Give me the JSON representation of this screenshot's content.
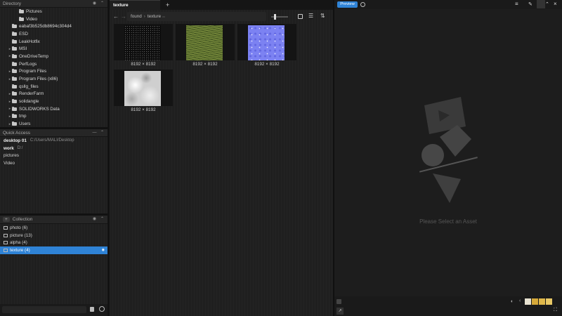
{
  "directory": {
    "title": "Directory",
    "items": [
      {
        "label": "Pictures",
        "depth": 2,
        "arrow": false
      },
      {
        "label": "Video",
        "depth": 2,
        "arrow": false
      },
      {
        "label": "eabaf3b525db8694c304d4",
        "depth": 1,
        "arrow": false
      },
      {
        "label": "ESD",
        "depth": 1,
        "arrow": false
      },
      {
        "label": "LeakHotfix",
        "depth": 1,
        "arrow": false
      },
      {
        "label": "MSI",
        "depth": 1,
        "arrow": true
      },
      {
        "label": "OneDriveTemp",
        "depth": 1,
        "arrow": true
      },
      {
        "label": "PerfLogs",
        "depth": 1,
        "arrow": false
      },
      {
        "label": "Program Files",
        "depth": 1,
        "arrow": true
      },
      {
        "label": "Program Files (x86)",
        "depth": 1,
        "arrow": true
      },
      {
        "label": "qsllg_files",
        "depth": 1,
        "arrow": false
      },
      {
        "label": "RenderFarm",
        "depth": 1,
        "arrow": true
      },
      {
        "label": "solidangle",
        "depth": 1,
        "arrow": true
      },
      {
        "label": "SOLIDWORKS Data",
        "depth": 1,
        "arrow": true
      },
      {
        "label": "tmp",
        "depth": 1,
        "arrow": true
      },
      {
        "label": "Users",
        "depth": 1,
        "arrow": true
      }
    ]
  },
  "quick_access": {
    "title": "Quick Access",
    "items": [
      {
        "label": "desktop 01",
        "path": "C:/Users/MALI/Desktop"
      },
      {
        "label": "work",
        "path": "D:/"
      },
      {
        "label": "pictures",
        "path": ""
      },
      {
        "label": "Video",
        "path": ""
      }
    ]
  },
  "collection": {
    "title": "Collection",
    "add_label": "+",
    "items": [
      {
        "label": "photo (6)"
      },
      {
        "label": "picture (13)"
      },
      {
        "label": "alpha (4)"
      },
      {
        "label": "texture (4)"
      }
    ]
  },
  "tabs": {
    "active": "texture",
    "add": "+"
  },
  "breadcrumb": {
    "parent": "found",
    "sep": "›",
    "current": "texture",
    "current_suffix": "▭"
  },
  "thumbnails": [
    {
      "label": "8192 × 8192",
      "kind": "noise-dark"
    },
    {
      "label": "8192 × 8192",
      "kind": "grass"
    },
    {
      "label": "8192 × 8192",
      "kind": "normal"
    },
    {
      "label": "8192 × 8192",
      "kind": "cloud"
    }
  ],
  "preview": {
    "button_label": "Preview",
    "empty_message": "Please Select an Asset"
  },
  "colors": {
    "accent": "#2f83d6",
    "swatches": [
      "#e8e3d2",
      "#d6a93a",
      "#e0b84a",
      "#e8c866"
    ]
  }
}
